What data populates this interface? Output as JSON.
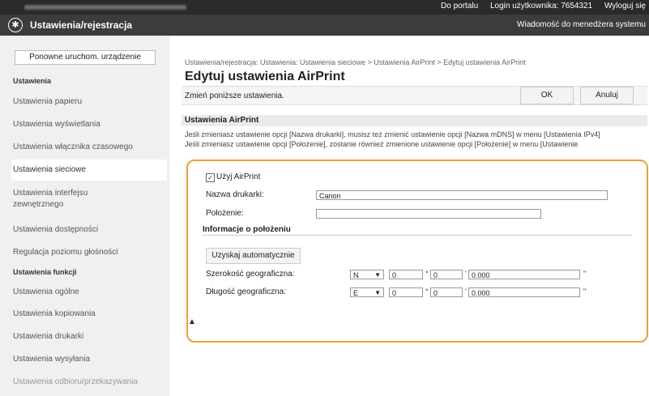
{
  "topbar": {
    "portal_link": "Do portalu",
    "login_label": "Login użytkownika:",
    "login_value": "7654321",
    "logout_link": "Wyloguj się"
  },
  "header": {
    "app_title": "Ustawienia/rejestracja",
    "admin_message_link": "Wiadomość do menedżera systemu"
  },
  "sidebar": {
    "restart_button": "Ponowne uruchom. urządzenie",
    "section1": "Ustawienia",
    "items1": [
      "Ustawienia papieru",
      "Ustawienia wyświetlania",
      "Ustawienia włącznika czasowego",
      "Ustawienia sieciowe",
      "Ustawienia interfejsu zewnętrznego",
      "Ustawienia dostępności",
      "Regulacja poziomu głośności"
    ],
    "section2": "Ustawienia funkcji",
    "items2": [
      "Ustawienia ogólne",
      "Ustawienia kopiowania",
      "Ustawienia drukarki",
      "Ustawienia wysyłania",
      "Ustawienia odbioru/przekazywania"
    ]
  },
  "main": {
    "breadcrumb": "Ustawienia/rejestracja: Ustawienia: Ustawienia sieciowe > Ustawienia AirPrint > Edytuj ustawienia AirPrint",
    "title": "Edytuj ustawienia AirPrint",
    "instruction": "Zmień poniższe ustawienia.",
    "ok_button": "OK",
    "cancel_button": "Anuluj",
    "section_title": "Ustawienia AirPrint",
    "note1": "Jeśli zmieniasz ustawienie opcji [Nazwa drukarki], musisz też zmienić ustawienie opcji [Nazwa mDNS] w menu [Ustawienia IPv4]",
    "note2": "Jeśli zmieniasz ustawienie opcji [Położenie], zostanie również zmienione ustawienie opcji [Położenie] w menu [Ustawienie"
  },
  "form": {
    "use_airprint_label": "Użyj AirPrint",
    "use_airprint_checked": "✓",
    "printer_name_label": "Nazwa drukarki:",
    "printer_name_value": "Canon",
    "location_label": "Położenie:",
    "location_value": "",
    "location_info_header": "Informacje o położeniu",
    "get_auto_button": "Uzyskaj automatycznie",
    "latitude_label": "Szerokość geograficzna:",
    "latitude_dir": "N",
    "latitude_deg": "0",
    "latitude_min": "0",
    "latitude_sec": "0.000",
    "longitude_label": "Długość geograficzna:",
    "longitude_dir": "E",
    "longitude_deg": "0",
    "longitude_min": "0",
    "longitude_sec": "0.000",
    "deg_symbol": "°",
    "min_symbol": "'",
    "sec_symbol": "\""
  },
  "colors": {
    "highlight_border": "#f0a030",
    "header_bg": "#3c3c3c"
  }
}
